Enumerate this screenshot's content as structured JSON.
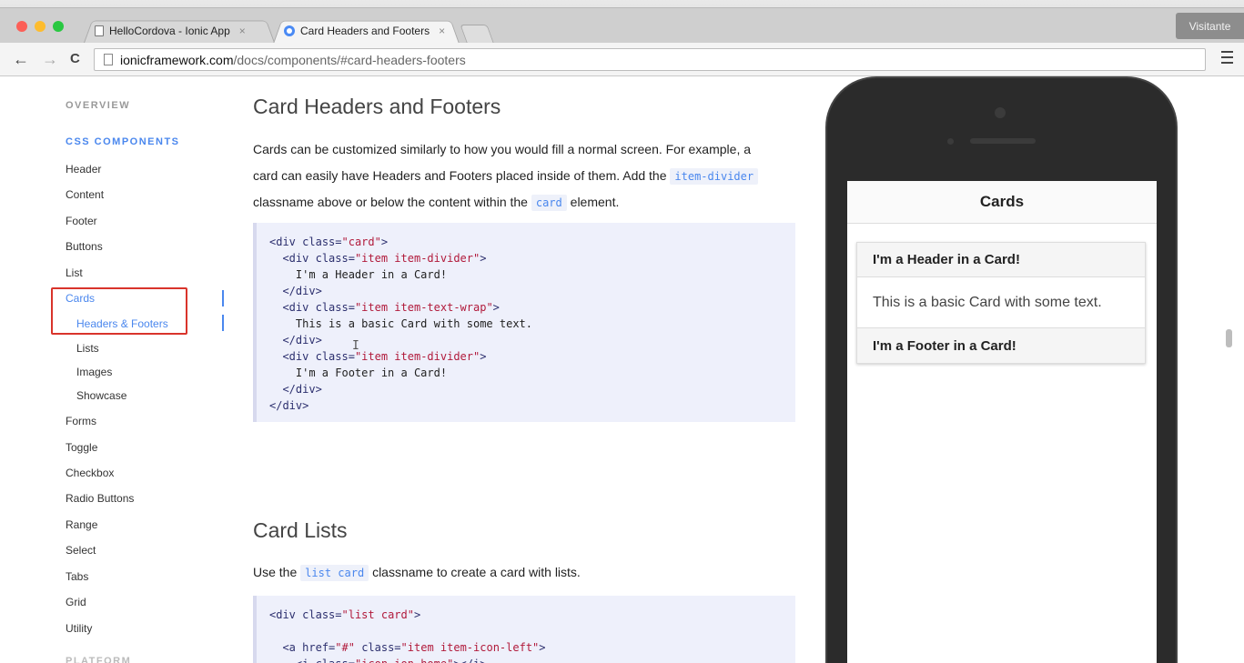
{
  "browser": {
    "tabs": [
      {
        "title": "HelloCordova - Ionic App",
        "close": "×"
      },
      {
        "title": "Card Headers and Footers",
        "close": "×"
      }
    ],
    "profile": "Visitante",
    "nav": {
      "back": "←",
      "forward": "→",
      "reload": "C"
    },
    "url": {
      "host": "ionicframework.com",
      "path": "/docs/components/#card-headers-footers"
    }
  },
  "sidebar": {
    "overview": "OVERVIEW",
    "css_components": "CSS COMPONENTS",
    "items": [
      "Header",
      "Content",
      "Footer",
      "Buttons",
      "List"
    ],
    "cards": "Cards",
    "card_subitems": [
      "Headers & Footers",
      "Lists",
      "Images",
      "Showcase"
    ],
    "items_after": [
      "Forms",
      "Toggle",
      "Checkbox",
      "Radio Buttons",
      "Range",
      "Select",
      "Tabs",
      "Grid",
      "Utility"
    ],
    "platform": "PLATFORM"
  },
  "content": {
    "section1": {
      "title": "Card Headers and Footers",
      "p1": "Cards can be customized similarly to how you would fill a normal screen. For example, a",
      "p2_pre": "card can easily have Headers and Footers placed inside of them. Add the",
      "p2_code": "item-divider",
      "p3_pre": "classname above or below the content within the",
      "p3_code": "card",
      "p3_post": "element."
    },
    "section2": {
      "title": "Card Lists",
      "p_pre": "Use the",
      "p_code": "list card",
      "p_post": "classname to create a card with lists."
    }
  },
  "phone": {
    "title": "Cards",
    "card": {
      "header": "I'm a Header in a Card!",
      "body": "This is a basic Card with some text.",
      "footer": "I'm a Footer in a Card!"
    }
  },
  "colors": {
    "accent": "#4a87ee",
    "highlight_box": "#d9342b",
    "code_bg": "#eef0fb",
    "string": "#b11a3b"
  }
}
